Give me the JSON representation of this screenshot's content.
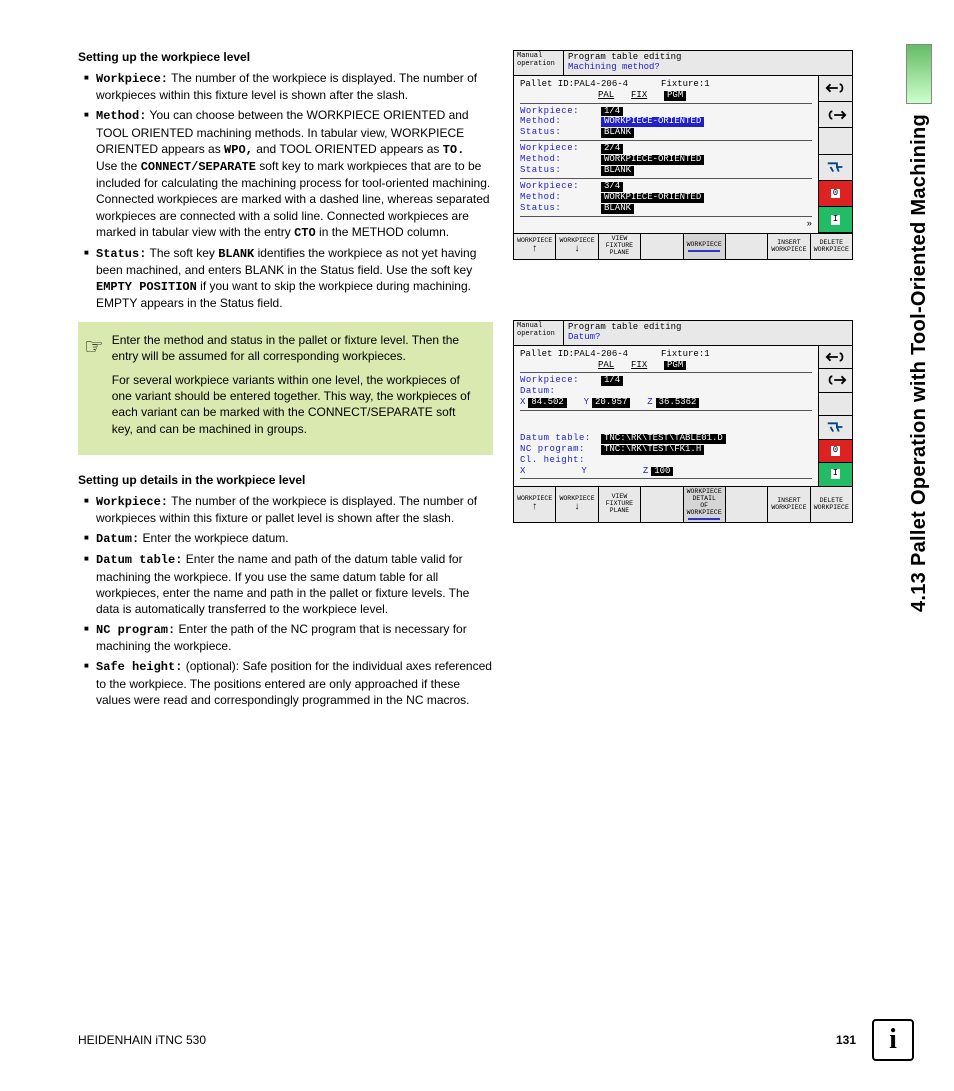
{
  "vertical_tab": "4.13 Pallet Operation with Tool-Oriented Machining",
  "section1": {
    "heading": "Setting up the workpiece level",
    "items": [
      {
        "label": "Workpiece:",
        "text": " The number of the workpiece is displayed. The number of workpieces within this fixture level is shown after the slash."
      },
      {
        "label": "Method:",
        "text": " You can choose between the WORKPIECE ORIENTED and TOOL ORIENTED machining methods. In tabular view, WORKPIECE ORIENTED appears as ",
        "mono1": "WPO,",
        "text2": " and TOOL ORIENTED appears as ",
        "mono2": "TO.",
        "text3": " Use the ",
        "mono3": "CONNECT/SEPARATE",
        "text4": " soft key to mark workpieces that are to be included for calculating the machining process for tool-oriented machining. Connected workpieces are marked with a dashed line, whereas separated workpieces are connected with a solid line. Connected workpieces are marked in tabular view with the entry ",
        "mono4": "CTO",
        "text5": " in the METHOD column."
      },
      {
        "label": "Status:",
        "text": " The soft key ",
        "mono1": "BLANK",
        "text2": " identifies the workpiece as not yet having been machined, and enters BLANK in the Status field. Use the soft key ",
        "mono2": "EMPTY POSITION",
        "text3": " if you want to skip the workpiece during machining. EMPTY appears in the Status field."
      }
    ]
  },
  "note": {
    "p1": "Enter the method and status in the pallet or fixture level. Then the entry will be assumed for all corresponding workpieces.",
    "p2": "For several workpiece variants within one level, the workpieces of one variant should be entered together. This way, the workpieces of each variant can be marked with the CONNECT/SEPARATE soft key, and can be machined in groups."
  },
  "section2": {
    "heading": "Setting up details in the workpiece level",
    "items": [
      {
        "label": "Workpiece:",
        "text": " The number of the workpiece is displayed. The number of workpieces within this fixture or pallet level is shown after the slash."
      },
      {
        "label": "Datum:",
        "text": " Enter the workpiece datum."
      },
      {
        "label": "Datum table:",
        "text": " Enter the name and path of the datum table valid for machining the workpiece. If you use the same datum table for all workpieces, enter the name and path in the pallet or fixture levels. The data is automatically transferred to the workpiece level."
      },
      {
        "label": "NC program:",
        "text": " Enter the path of the NC program that is necessary for machining the workpiece."
      },
      {
        "label": "Safe height:",
        "text": " (optional): Safe position for the individual axes referenced to the workpiece. The positions entered are only approached if these values were read and correspondingly programmed in the NC macros."
      }
    ]
  },
  "screen1": {
    "mode": "Manual operation",
    "title": "Program table editing",
    "sub": "Machining method?",
    "pallet": "Pallet ID:PAL4-206-4",
    "fixture": "Fixture:1",
    "nav": {
      "pal": "PAL",
      "fix": "FIX",
      "pgm": "PGM"
    },
    "groups": [
      {
        "wp": "1/4",
        "method": "WORKPIECE-ORIENTED",
        "status": "BLANK",
        "sel": true
      },
      {
        "wp": "2/4",
        "method": "WORKPIECE-ORIENTED",
        "status": "BLANK"
      },
      {
        "wp": "3/4",
        "method": "WORKPIECE-ORIENTED",
        "status": "BLANK"
      }
    ],
    "labels": {
      "wp": "Workpiece:",
      "method": "Method:",
      "status": "Status:"
    },
    "softkeys": [
      "WORKPIECE",
      "WORKPIECE",
      "VIEW FIXTURE PLANE",
      "",
      "WORKPIECE",
      "",
      "INSERT WORKPIECE",
      "DELETE WORKPIECE"
    ]
  },
  "screen2": {
    "mode": "Manual operation",
    "title": "Program table editing",
    "sub": "Datum?",
    "pallet": "Pallet ID:PAL4-206-4",
    "fixture": "Fixture:1",
    "nav": {
      "pal": "PAL",
      "fix": "FIX",
      "pgm": "PGM"
    },
    "labels": {
      "wp": "Workpiece:",
      "datum": "Datum:",
      "dtable": "Datum table:",
      "nc": "NC program:",
      "cl": "Cl. height:"
    },
    "wp": "1/4",
    "x": "84.502",
    "y": "20.957",
    "z": "36.5362",
    "xl": "X",
    "yl": "Y",
    "zl": "Z",
    "dtable": "TNC:\\RK\\TEST\\TABLE01.D",
    "nc": "TNC:\\RK\\TEST\\FK1.H",
    "clx": "",
    "cly": "",
    "clz": "100",
    "softkeys": [
      "WORKPIECE",
      "WORKPIECE",
      "VIEW FIXTURE PLANE",
      "",
      "WORKPIECE DETAIL OF WORKPIECE",
      "",
      "INSERT WORKPIECE",
      "DELETE WORKPIECE"
    ]
  },
  "footer": {
    "left": "HEIDENHAIN iTNC 530",
    "page": "131"
  }
}
